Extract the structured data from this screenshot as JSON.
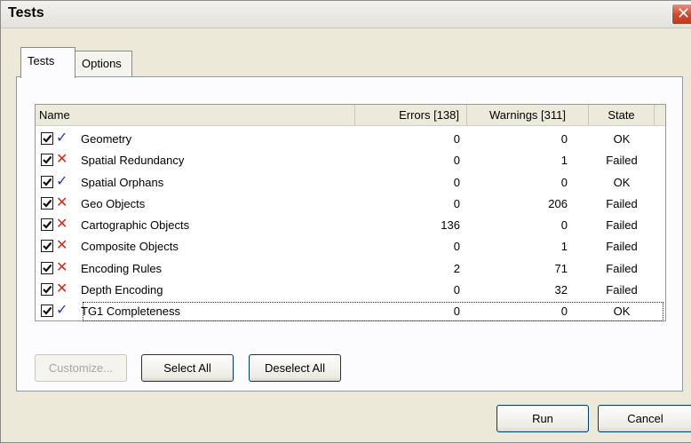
{
  "window": {
    "title": "Tests",
    "close_glyph": "✕"
  },
  "tabs": [
    {
      "label": "Tests",
      "active": true
    },
    {
      "label": "Options",
      "active": false
    }
  ],
  "table": {
    "columns": {
      "name": "Name",
      "errors": "Errors [138]",
      "warnings": "Warnings [311]",
      "state": "State"
    },
    "rows": [
      {
        "checked": true,
        "status": "ok",
        "name": "Geometry",
        "errors": "0",
        "warnings": "0",
        "state": "OK"
      },
      {
        "checked": true,
        "status": "fail",
        "name": "Spatial Redundancy",
        "errors": "0",
        "warnings": "1",
        "state": "Failed"
      },
      {
        "checked": true,
        "status": "ok",
        "name": "Spatial Orphans",
        "errors": "0",
        "warnings": "0",
        "state": "OK"
      },
      {
        "checked": true,
        "status": "fail",
        "name": "Geo Objects",
        "errors": "0",
        "warnings": "206",
        "state": "Failed"
      },
      {
        "checked": true,
        "status": "fail",
        "name": "Cartographic Objects",
        "errors": "136",
        "warnings": "0",
        "state": "Failed"
      },
      {
        "checked": true,
        "status": "fail",
        "name": "Composite Objects",
        "errors": "0",
        "warnings": "1",
        "state": "Failed"
      },
      {
        "checked": true,
        "status": "fail",
        "name": "Encoding Rules",
        "errors": "2",
        "warnings": "71",
        "state": "Failed"
      },
      {
        "checked": true,
        "status": "fail",
        "name": "Depth Encoding",
        "errors": "0",
        "warnings": "32",
        "state": "Failed"
      },
      {
        "checked": true,
        "status": "ok",
        "name": "TG1 Completeness",
        "errors": "0",
        "warnings": "0",
        "state": "OK"
      }
    ]
  },
  "buttons": {
    "customize": "Customize...",
    "select_all": "Select All",
    "deselect_all": "Deselect All",
    "run": "Run",
    "cancel": "Cancel"
  },
  "icons": {
    "ok": "check-icon",
    "fail": "cross-icon"
  },
  "colors": {
    "ok": "#1a3fb8",
    "fail": "#d42a1a"
  }
}
